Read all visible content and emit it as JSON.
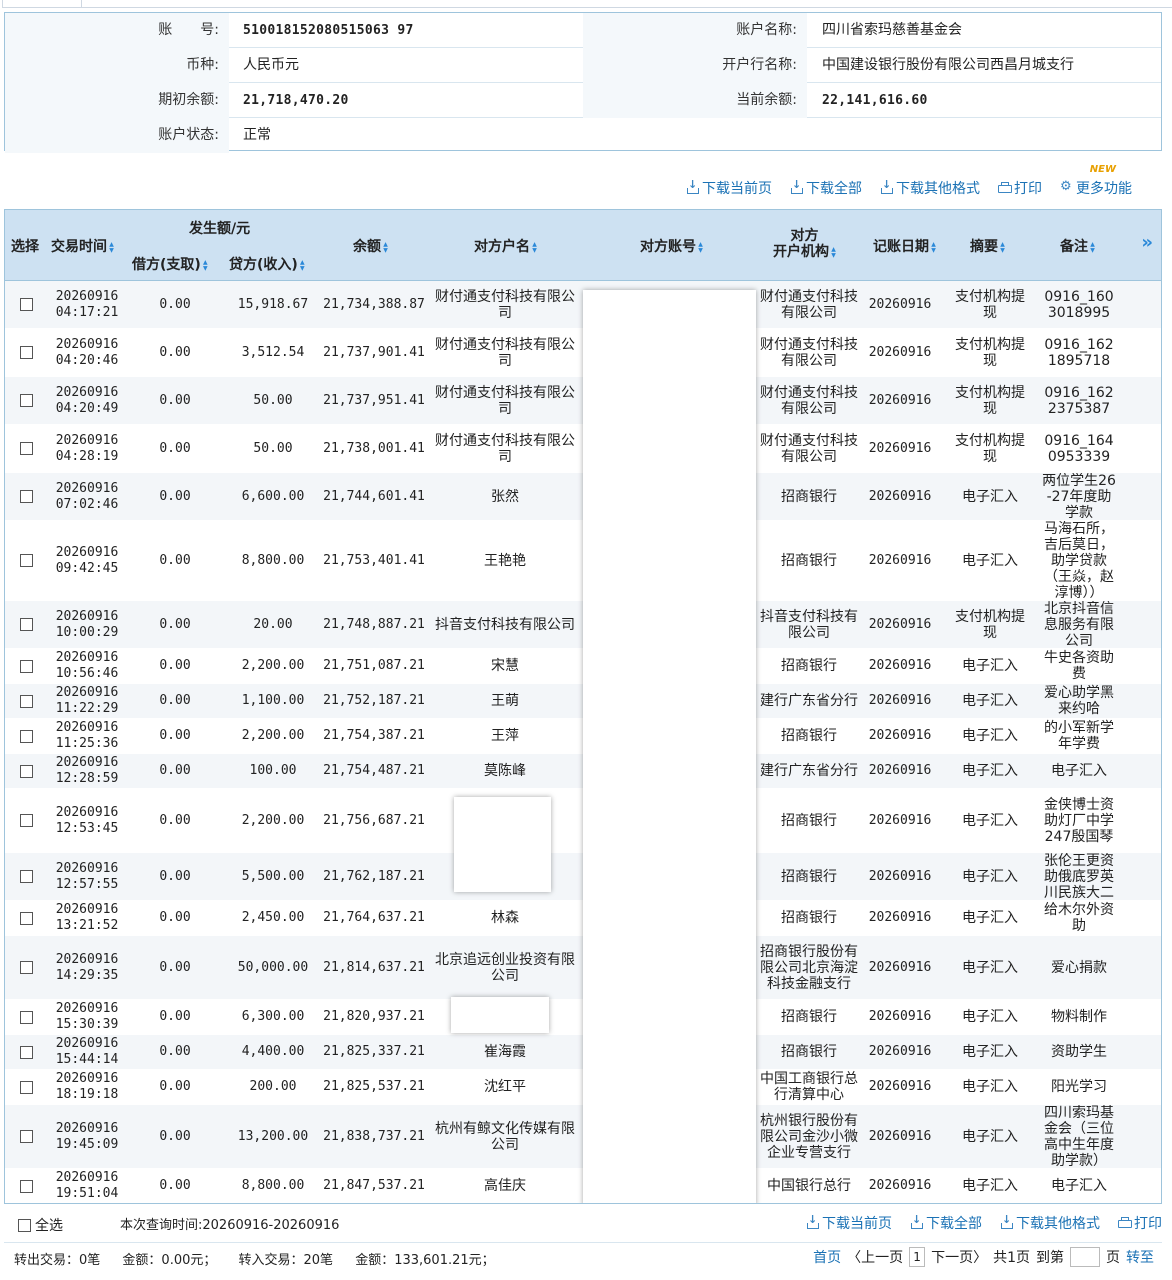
{
  "account": {
    "account_no_label": "账　　号:",
    "account_no": "510018152080515063 97",
    "account_name_label": "账户名称:",
    "account_name": "四川省索玛慈善基金会",
    "currency_label": "币种:",
    "currency": "人民币元",
    "bank_label": "开户行名称:",
    "bank": "中国建设银行股份有限公司西昌月城支行",
    "opening_balance_label": "期初余额:",
    "opening_balance": "21,718,470.20",
    "current_balance_label": "当前余额:",
    "current_balance": "22,141,616.60",
    "status_label": "账户状态:",
    "status": "正常"
  },
  "toolbar": {
    "download_page": "下载当前页",
    "download_all": "下载全部",
    "download_other": "下载其他格式",
    "print": "打印",
    "more": "更多功能",
    "new_badge": "NEW"
  },
  "table": {
    "headers": {
      "select": "选择",
      "time": "交易时间",
      "amount_group": "发生额/元",
      "debit": "借方(支取)",
      "credit": "贷方(收入)",
      "balance": "余额",
      "counter_name": "对方户名",
      "counter_account": "对方账号",
      "counter_bank": "对方\n开户机构",
      "post_date": "记账日期",
      "summary": "摘要",
      "remark": "备注",
      "more": "»"
    },
    "rows": [
      {
        "date": "20260916",
        "time": "04:17:21",
        "debit": "0.00",
        "credit": "15,918.67",
        "balance": "21,734,388.87",
        "name": "财付通支付科技有限公司",
        "bank": "财付通支付科技有限公司",
        "post": "20260916",
        "summary": "支付机构提现",
        "remark": "0916_1603018995"
      },
      {
        "date": "20260916",
        "time": "04:20:46",
        "debit": "0.00",
        "credit": "3,512.54",
        "balance": "21,737,901.41",
        "name": "财付通支付科技有限公司",
        "bank": "财付通支付科技有限公司",
        "post": "20260916",
        "summary": "支付机构提现",
        "remark": "0916_1621895718"
      },
      {
        "date": "20260916",
        "time": "04:20:49",
        "debit": "0.00",
        "credit": "50.00",
        "balance": "21,737,951.41",
        "name": "财付通支付科技有限公司",
        "bank": "财付通支付科技有限公司",
        "post": "20260916",
        "summary": "支付机构提现",
        "remark": "0916_1622375387"
      },
      {
        "date": "20260916",
        "time": "04:28:19",
        "debit": "0.00",
        "credit": "50.00",
        "balance": "21,738,001.41",
        "name": "财付通支付科技有限公司",
        "bank": "财付通支付科技有限公司",
        "post": "20260916",
        "summary": "支付机构提现",
        "remark": "0916_1640953339"
      },
      {
        "date": "20260916",
        "time": "07:02:46",
        "debit": "0.00",
        "credit": "6,600.00",
        "balance": "21,744,601.41",
        "name": "张然",
        "bank": "招商银行",
        "post": "20260916",
        "summary": "电子汇入",
        "remark": "两位学生26-27年度助学款"
      },
      {
        "date": "20260916",
        "time": "09:42:45",
        "debit": "0.00",
        "credit": "8,800.00",
        "balance": "21,753,401.41",
        "name": "王艳艳",
        "bank": "招商银行",
        "post": "20260916",
        "summary": "电子汇入",
        "remark": "马海石所，吉后莫日，助学贷款（王焱，赵淳博））"
      },
      {
        "date": "20260916",
        "time": "10:00:29",
        "debit": "0.00",
        "credit": "20.00",
        "balance": "21,748,887.21",
        "name": "抖音支付科技有限公司",
        "bank": "抖音支付科技有限公司",
        "post": "20260916",
        "summary": "支付机构提现",
        "remark": "北京抖音信息服务有限公司"
      },
      {
        "date": "20260916",
        "time": "10:56:46",
        "debit": "0.00",
        "credit": "2,200.00",
        "balance": "21,751,087.21",
        "name": "宋慧",
        "bank": "招商银行",
        "post": "20260916",
        "summary": "电子汇入",
        "remark": "牛史各资助费"
      },
      {
        "date": "20260916",
        "time": "11:22:29",
        "debit": "0.00",
        "credit": "1,100.00",
        "balance": "21,752,187.21",
        "name": "王萌",
        "bank": "建行广东省分行",
        "post": "20260916",
        "summary": "电子汇入",
        "remark": "爱心助学黑来约哈"
      },
      {
        "date": "20260916",
        "time": "11:25:36",
        "debit": "0.00",
        "credit": "2,200.00",
        "balance": "21,754,387.21",
        "name": "王萍",
        "bank": "招商银行",
        "post": "20260916",
        "summary": "电子汇入",
        "remark": "的小军新学年学费"
      },
      {
        "date": "20260916",
        "time": "12:28:59",
        "debit": "0.00",
        "credit": "100.00",
        "balance": "21,754,487.21",
        "name": "莫陈峰",
        "bank": "建行广东省分行",
        "post": "20260916",
        "summary": "电子汇入",
        "remark": "电子汇入"
      },
      {
        "date": "20260916",
        "time": "12:53:45",
        "debit": "0.00",
        "credit": "2,200.00",
        "balance": "21,756,687.21",
        "name": "",
        "bank": "招商银行",
        "post": "20260916",
        "summary": "电子汇入",
        "remark": "金侠博士资助灯厂中学247殷国琴"
      },
      {
        "date": "20260916",
        "time": "12:57:55",
        "debit": "0.00",
        "credit": "5,500.00",
        "balance": "21,762,187.21",
        "name": "",
        "bank": "招商银行",
        "post": "20260916",
        "summary": "电子汇入",
        "remark": "张伦王更资助俄底罗英川民族大二"
      },
      {
        "date": "20260916",
        "time": "13:21:52",
        "debit": "0.00",
        "credit": "2,450.00",
        "balance": "21,764,637.21",
        "name": "林森",
        "bank": "招商银行",
        "post": "20260916",
        "summary": "电子汇入",
        "remark": "给木尔外资助"
      },
      {
        "date": "20260916",
        "time": "14:29:35",
        "debit": "0.00",
        "credit": "50,000.00",
        "balance": "21,814,637.21",
        "name": "北京追远创业投资有限公司",
        "bank": "招商银行股份有限公司北京海淀科技金融支行",
        "post": "20260916",
        "summary": "电子汇入",
        "remark": "爱心捐款"
      },
      {
        "date": "20260916",
        "time": "15:30:39",
        "debit": "0.00",
        "credit": "6,300.00",
        "balance": "21,820,937.21",
        "name": "",
        "bank": "招商银行",
        "post": "20260916",
        "summary": "电子汇入",
        "remark": "物料制作"
      },
      {
        "date": "20260916",
        "time": "15:44:14",
        "debit": "0.00",
        "credit": "4,400.00",
        "balance": "21,825,337.21",
        "name": "崔海霞",
        "bank": "招商银行",
        "post": "20260916",
        "summary": "电子汇入",
        "remark": "资助学生"
      },
      {
        "date": "20260916",
        "time": "18:19:18",
        "debit": "0.00",
        "credit": "200.00",
        "balance": "21,825,537.21",
        "name": "沈红平",
        "bank": "中国工商银行总行清算中心",
        "post": "20260916",
        "summary": "电子汇入",
        "remark": "阳光学习"
      },
      {
        "date": "20260916",
        "time": "19:45:09",
        "debit": "0.00",
        "credit": "13,200.00",
        "balance": "21,838,737.21",
        "name": "杭州有鲸文化传媒有限公司",
        "bank": "杭州银行股份有限公司金沙小微企业专营支行",
        "post": "20260916",
        "summary": "电子汇入",
        "remark": "四川索玛基金会（三位高中生年度助学款）"
      },
      {
        "date": "20260916",
        "time": "19:51:04",
        "debit": "0.00",
        "credit": "8,800.00",
        "balance": "21,847,537.21",
        "name": "高佳庆",
        "bank": "中国银行总行",
        "post": "20260916",
        "summary": "电子汇入",
        "remark": "电子汇入"
      }
    ]
  },
  "footer": {
    "select_all": "全选",
    "query_time": "本次查询时间:20260916-20260916",
    "download_page": "下载当前页",
    "download_all": "下载全部",
    "download_other": "下载其他格式",
    "print": "打印",
    "summary": {
      "out_count": "转出交易：0笔",
      "out_amount": "金额：0.00元；",
      "in_count": "转入交易：20笔",
      "in_amount": "金额：133,601.21元；"
    },
    "pager": {
      "first": "首页",
      "prev": "〈上一页",
      "current": "1",
      "next": "下一页〉",
      "total": "共1页",
      "goto_label": "到第",
      "page_unit": "页",
      "go": "转至"
    }
  }
}
